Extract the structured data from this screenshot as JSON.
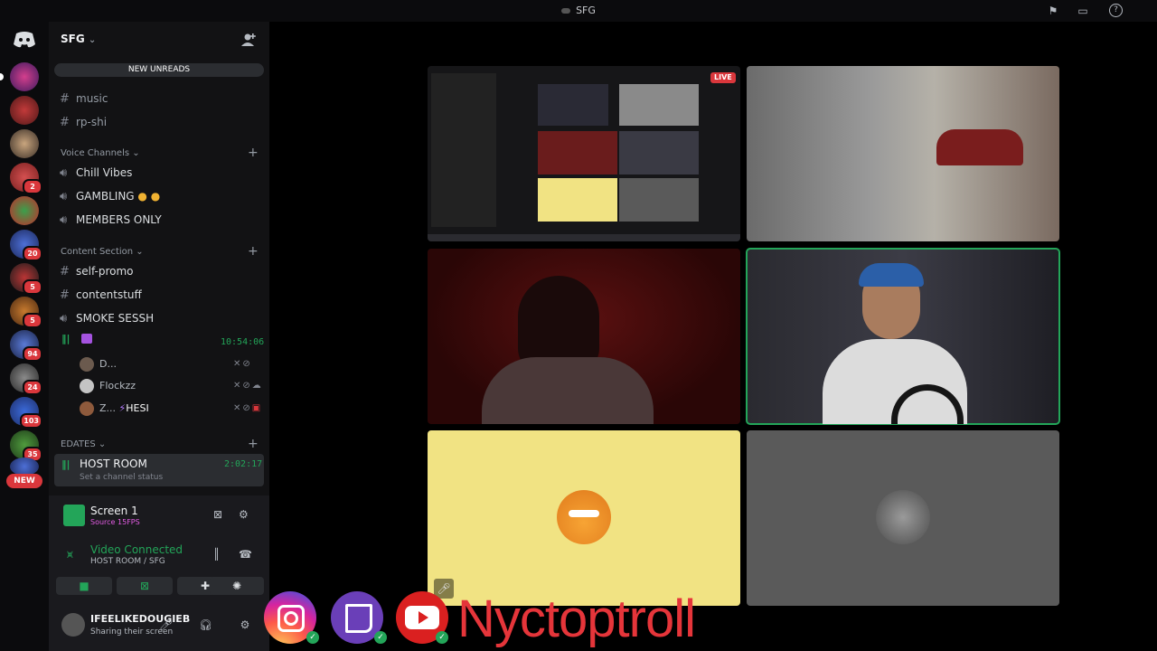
{
  "window": {
    "title": "SFG"
  },
  "server": {
    "name": "SFG",
    "new_unreads_label": "NEW UNREADS",
    "new_label": "NEW",
    "badges": [
      "2",
      "20",
      "5",
      "5",
      "94",
      "24",
      "103",
      "35"
    ]
  },
  "channels": {
    "text_top": [
      "music",
      "rp-shi"
    ],
    "voice_category": "Voice Channels",
    "voice": [
      "Chill Vibes",
      "GAMBLING",
      "MEMBERS ONLY"
    ],
    "content_category": "Content Section",
    "content_text": [
      "self-promo",
      "contentstuff"
    ],
    "smoke": "SMOKE SESSH",
    "stream_time": "10:54:06",
    "members": [
      "D...",
      "Flockzz",
      "Z...",
      "HESI"
    ],
    "edates_category": "EDATES",
    "host_room": "HOST ROOM",
    "host_status": "Set a channel status",
    "host_time": "2:02:17"
  },
  "panel": {
    "screen_title": "Screen 1",
    "screen_sub": "Source 15FPS",
    "vc_title": "Video Connected",
    "vc_sub": "HOST ROOM / SFG",
    "username": "IFEELIKEDOUGIEB",
    "user_status": "Sharing their screen"
  },
  "stage": {
    "live_label": "LIVE"
  },
  "overlay": {
    "brand": "Nyctoptroll",
    "socials": [
      "instagram-icon",
      "twitch-icon",
      "youtube-icon"
    ]
  },
  "colors": {
    "green": "#23a559",
    "red": "#da373c",
    "yellow_tile": "#f1e383",
    "grey_tile": "#5a5a5a",
    "brand_red": "#e5353a"
  }
}
